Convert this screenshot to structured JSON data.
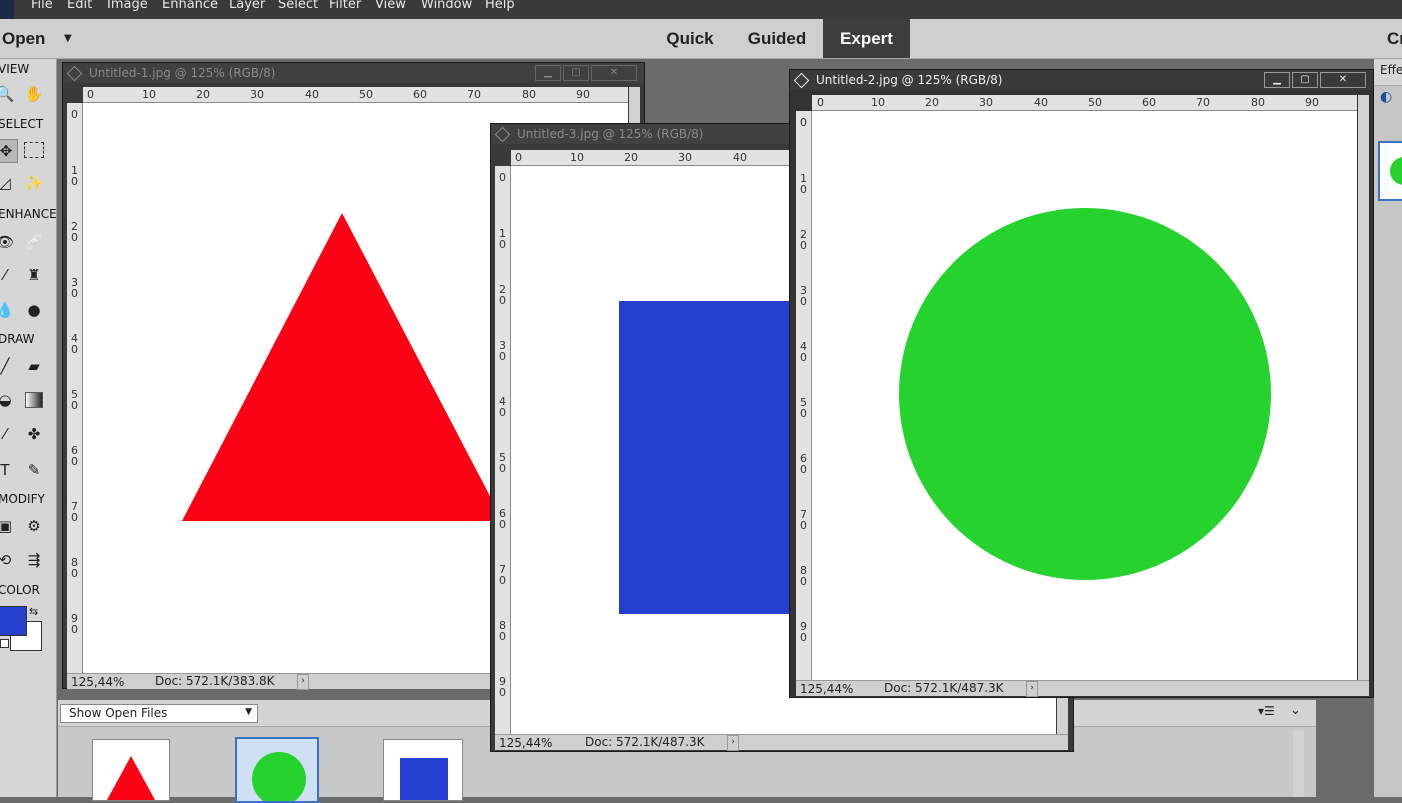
{
  "menu": [
    "File",
    "Edit",
    "Image",
    "Enhance",
    "Layer",
    "Select",
    "Filter",
    "View",
    "Window",
    "Help"
  ],
  "modebar": {
    "open_label": "Open",
    "modes": [
      "Quick",
      "Guided",
      "Expert"
    ],
    "active_mode": "Expert",
    "right_label": "Cr"
  },
  "tools": {
    "sections": [
      "VIEW",
      "SELECT",
      "ENHANCE",
      "DRAW",
      "MODIFY",
      "COLOR"
    ],
    "foreground_color": "#2540cc",
    "background_color": "#ffffff"
  },
  "right_panel": {
    "effects_label": "Effe"
  },
  "windows": {
    "w1": {
      "title": "Untitled-1.jpg @ 125% (RGB/8)",
      "zoom": "125,44%",
      "doc": "Doc: 572.1K/383.8K",
      "shape_color": "#fb0315"
    },
    "w3": {
      "title": "Untitled-3.jpg @ 125% (RGB/8)",
      "zoom": "125,44%",
      "doc": "Doc: 572.1K/487.3K",
      "shape_color": "#2540d0"
    },
    "w2": {
      "title": "Untitled-2.jpg @ 125% (RGB/8)",
      "zoom": "125,44%",
      "doc": "Doc: 572.1K/487.3K",
      "shape_color": "#26d22e"
    }
  },
  "ruler": {
    "h_labels": [
      "0",
      "10",
      "20",
      "30",
      "40",
      "50",
      "60",
      "70",
      "80",
      "90"
    ],
    "v_labels": [
      "0",
      "1 0",
      "2 0",
      "3 0",
      "4 0",
      "5 0",
      "6 0",
      "7 0",
      "8 0",
      "9 0"
    ]
  },
  "bin": {
    "show_label": "Show Open Files"
  }
}
